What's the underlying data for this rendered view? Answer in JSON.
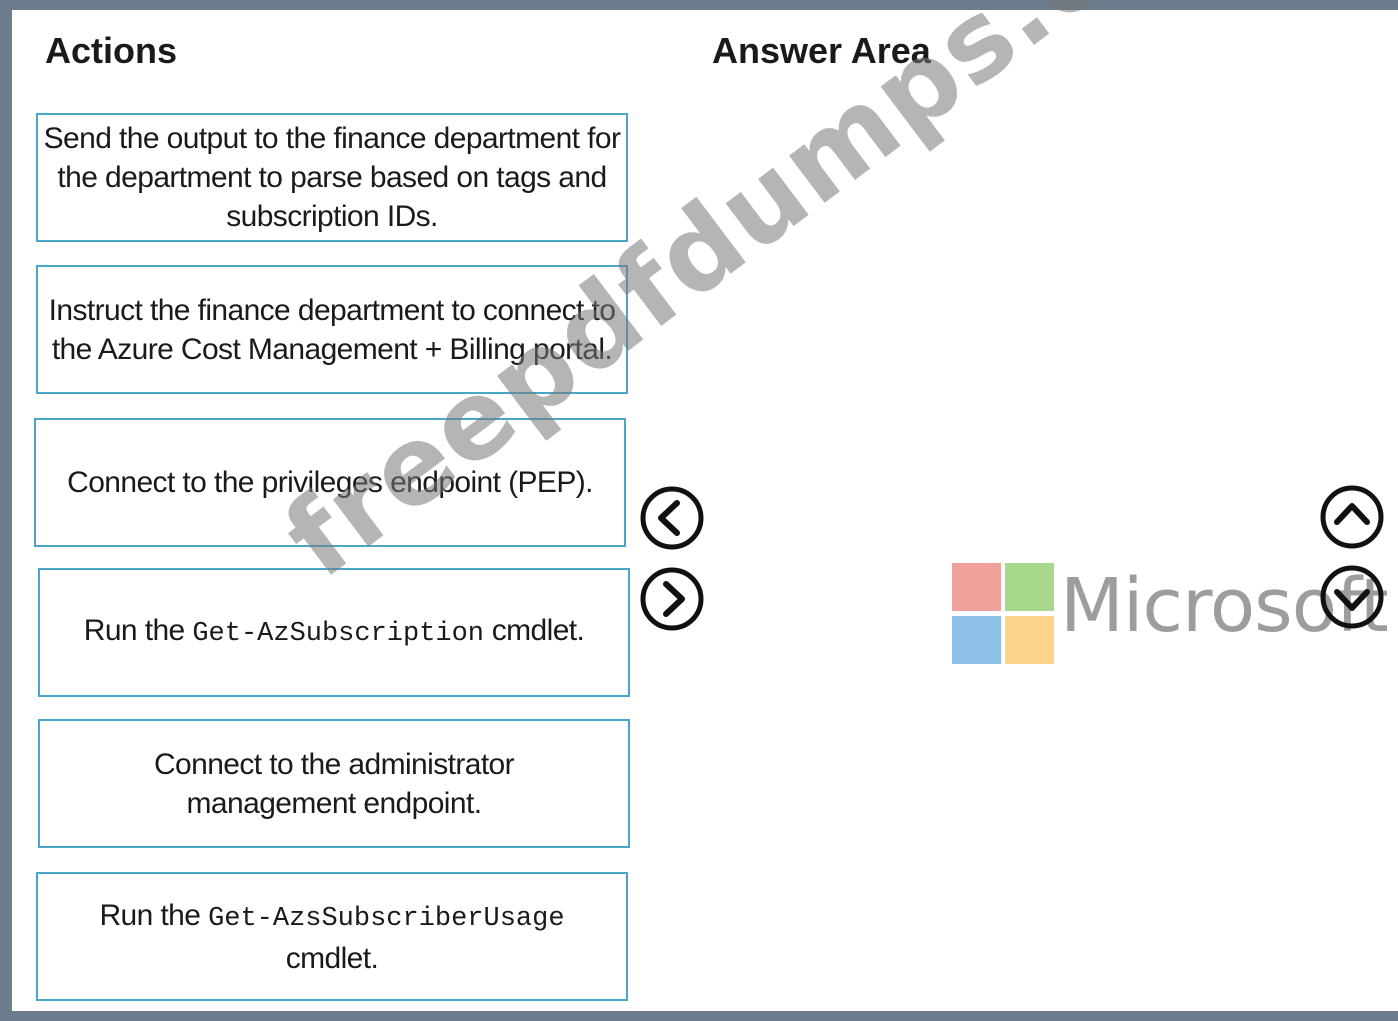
{
  "headings": {
    "actions": "Actions",
    "answer_area": "Answer Area"
  },
  "actions": [
    {
      "text": "Send the output to the finance department for the department to parse based on tags and subscription IDs."
    },
    {
      "text": "Instruct the finance department to connect to the Azure Cost Management + Billing portal."
    },
    {
      "text": "Connect to the privileges endpoint (PEP)."
    },
    {
      "prefix": "Run the ",
      "code": "Get-AzSubscription",
      "suffix": " cmdlet."
    },
    {
      "text": "Connect to the administrator management endpoint."
    },
    {
      "prefix": "Run the ",
      "code": "Get-AzsSubscriberUsage",
      "suffix": " cmdlet."
    }
  ],
  "controls": {
    "move_left_icon": "chevron-left-circle-icon",
    "move_right_icon": "chevron-right-circle-icon",
    "move_up_icon": "chevron-up-circle-icon",
    "move_down_icon": "chevron-down-circle-icon"
  },
  "logo": {
    "word": "Microsoft",
    "colors": {
      "red": "#f1a19b",
      "green": "#a8d88a",
      "blue": "#8fc2e8",
      "yellow": "#fdd28d"
    },
    "text_color": "#9d9d9d"
  },
  "watermark": "freepdfdumps.com",
  "colors": {
    "frame": "#6b7c8c",
    "box_border": "#4aa6c8"
  }
}
